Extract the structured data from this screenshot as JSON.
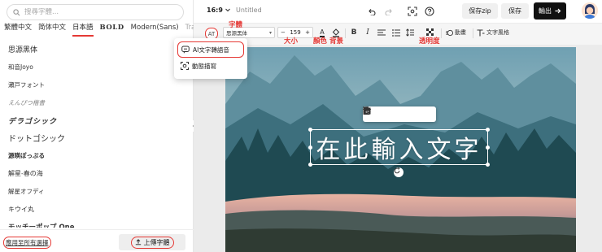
{
  "search": {
    "placeholder": "搜尋字體..."
  },
  "font_tabs": [
    {
      "label": "繁體中文"
    },
    {
      "label": "简体中文"
    },
    {
      "label": "日本語"
    },
    {
      "label": "BOLD"
    },
    {
      "label": "Modern(Sans)"
    },
    {
      "label": "Trad"
    }
  ],
  "fonts": [
    {
      "label": "思源黑体"
    },
    {
      "label": "和音Joyo"
    },
    {
      "label": "瀬戸フォント"
    },
    {
      "label": "えんぴつ楷書"
    },
    {
      "label": "デラゴシック"
    },
    {
      "label": "ドットゴシック"
    },
    {
      "label": "源暎ぽっぷる"
    },
    {
      "label": "解星-春の海"
    },
    {
      "label": "解星オフディ"
    },
    {
      "label": "キウイ丸"
    },
    {
      "label": "モッチーポップ One"
    }
  ],
  "bottom": {
    "apply_all": "應用至所有選擇",
    "upload": "上傳字體"
  },
  "topbar": {
    "ratio": "16:9",
    "doc_title": "Untitled",
    "save_zip": "保存zip",
    "save": "保存",
    "export": "輸出"
  },
  "text_toolbar": {
    "font_name": "思源黑体",
    "font_size": "159",
    "minus": "−",
    "plus": "+",
    "bold": "B",
    "italic": "I",
    "color_letter": "A",
    "ai_badge": "AT",
    "animation": "動畫",
    "text_style": "文字風格"
  },
  "annotations": {
    "font": "字體",
    "size": "大小",
    "color": "顏色",
    "background": "背景",
    "opacity": "透明度"
  },
  "canvas": {
    "text": "在此輸入文字"
  },
  "dropdown": [
    {
      "label": "AI文字轉語音"
    },
    {
      "label": "動態描寫"
    }
  ],
  "colors": {
    "accent": "#e53935",
    "export_bg": "#111111",
    "tab_underline": "#e53935"
  }
}
